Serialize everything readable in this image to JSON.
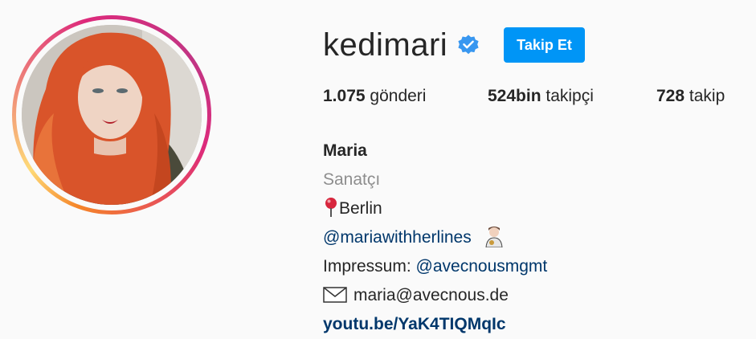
{
  "profile": {
    "username": "kedimari",
    "follow_label": "Takip Et",
    "stats": {
      "posts_count": "1.075",
      "posts_label": "gönderi",
      "followers_count": "524bin",
      "followers_label": "takipçi",
      "following_count": "728",
      "following_label": "takip"
    },
    "bio": {
      "name": "Maria",
      "category": "Sanatçı",
      "location": "Berlin",
      "mention": "@mariawithherlines",
      "impressum_label": "Impressum:",
      "impressum_handle": "@avecnousmgmt",
      "email": "maria@avecnous.de",
      "website": "youtu.be/YaK4TIQMqIc"
    }
  },
  "icons": {
    "verified": "verified-badge-icon",
    "location": "round-pushpin-icon",
    "mention_emoji": "artist-person-icon",
    "email": "envelope-icon"
  },
  "colors": {
    "accent": "#0095f6",
    "link": "#00376b",
    "muted": "#8e8e8e",
    "text": "#262626"
  }
}
